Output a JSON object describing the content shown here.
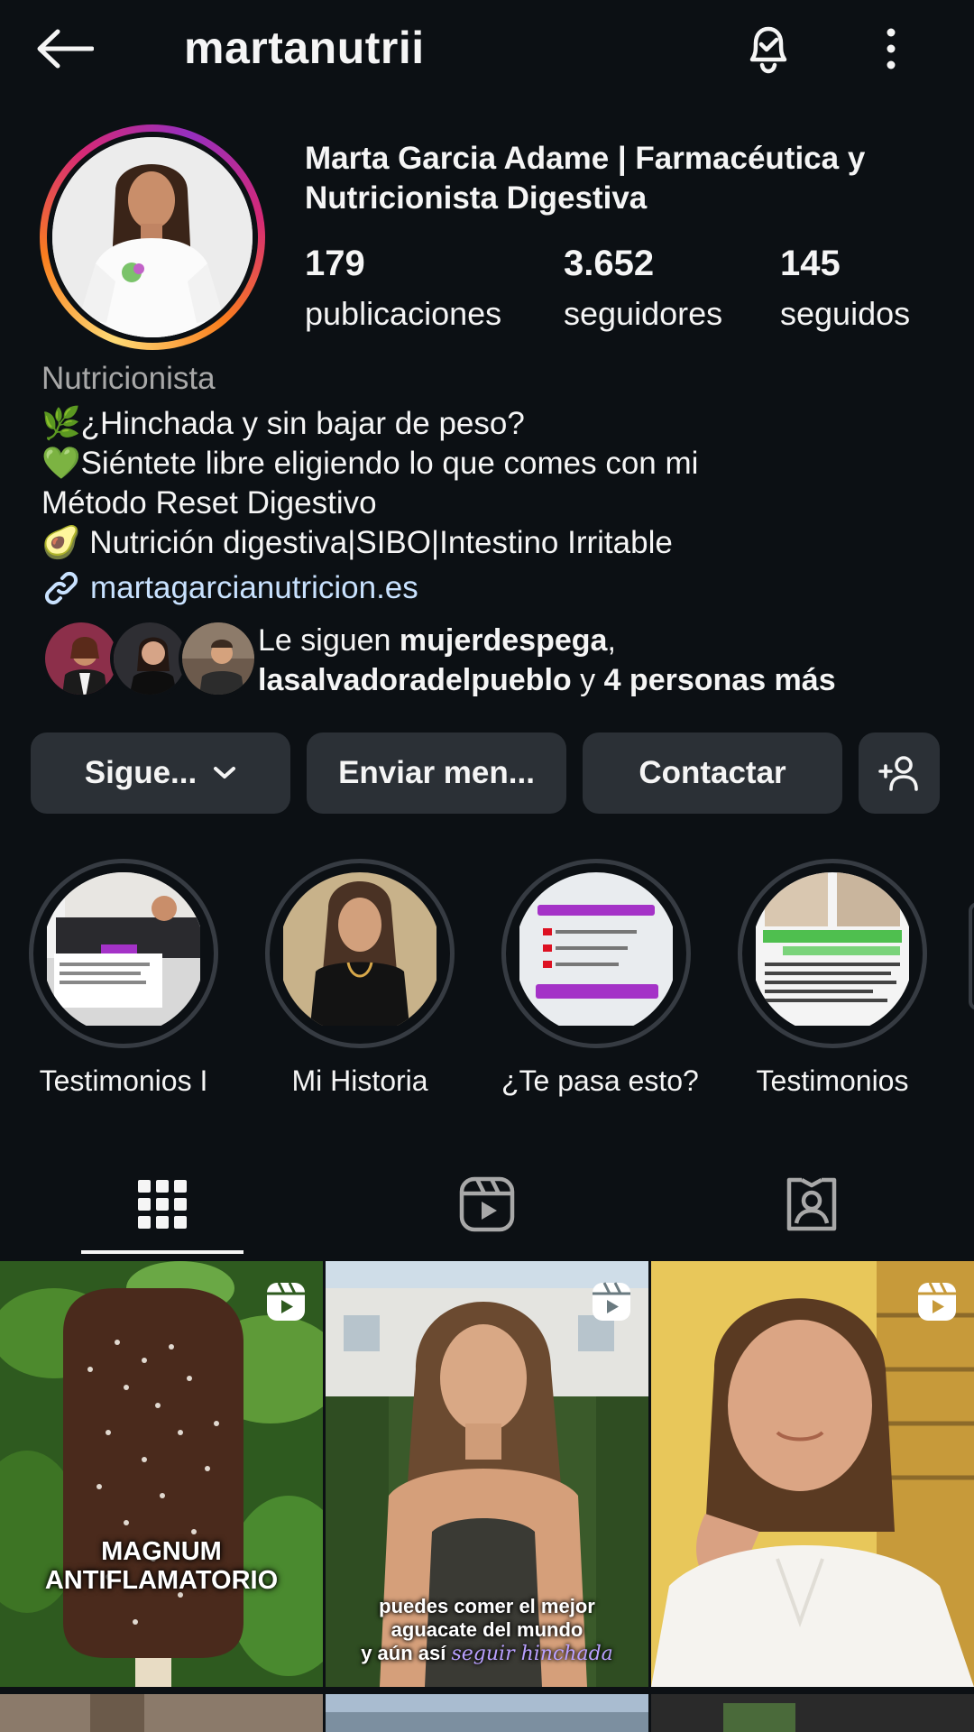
{
  "header": {
    "username": "martanutrii"
  },
  "profile": {
    "full_name": "Marta Garcia Adame | Farmacéutica y Nutricionista Digestiva",
    "stats": [
      {
        "value": "179",
        "label": "publicaciones"
      },
      {
        "value": "3.652",
        "label": "seguidores"
      },
      {
        "value": "145",
        "label": "seguidos"
      }
    ],
    "category": "Nutricionista",
    "bio_lines": [
      "🌿¿Hinchada y sin bajar de peso?",
      "💚Siéntete libre eligiendo lo que comes con mi",
      "Método Reset Digestivo",
      "🥑 Nutrición digestiva|SIBO|Intestino Irritable"
    ],
    "link": "martagarcianutricion.es",
    "followed_by": {
      "prefix": "Le siguen ",
      "user1": "mujerdespega",
      "sep": ",",
      "user2": "lasalvadoradelpueblo",
      "mid": " y ",
      "more": "4 personas más"
    }
  },
  "actions": {
    "following": "Sigue...",
    "message": "Enviar men...",
    "contact": "Contactar"
  },
  "highlights": [
    {
      "label": "Testimonios I"
    },
    {
      "label": "Mi Historia"
    },
    {
      "label": "¿Te pasa esto?"
    },
    {
      "label": "Testimonios"
    }
  ],
  "posts": [
    {
      "caption_lines": [
        "MAGNUM",
        "ANTIFLAMATORIO"
      ]
    },
    {
      "caption_lines": [
        "puedes comer el mejor",
        "aguacate del mundo",
        "y aún así "
      ],
      "caption_emph": "seguir hinchada"
    },
    {
      "caption_lines": []
    }
  ],
  "colors": {
    "background": "#0c1014",
    "button": "#2b3036",
    "link": "#c9e2ff"
  }
}
